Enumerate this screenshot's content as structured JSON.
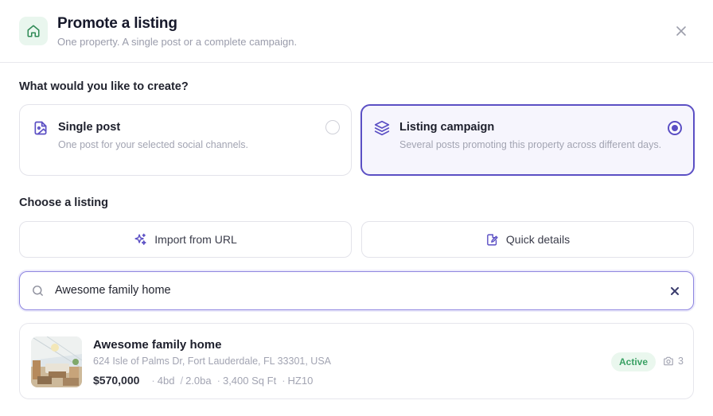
{
  "dialog": {
    "title": "Promote a listing",
    "subtitle": "One property. A single post or a complete campaign."
  },
  "create_section": {
    "label": "What would you like to create?",
    "options": [
      {
        "title": "Single post",
        "description": "One post for your selected social channels.",
        "selected": false,
        "icon": "image-post-icon"
      },
      {
        "title": "Listing campaign",
        "description": "Several posts promoting this property across different days.",
        "selected": true,
        "icon": "layers-icon"
      }
    ]
  },
  "listing_section": {
    "label": "Choose a listing",
    "import_button": "Import from URL",
    "quick_details_button": "Quick details"
  },
  "search": {
    "value": "Awesome family home",
    "placeholder": ""
  },
  "result": {
    "title": "Awesome family home",
    "address": "624 Isle of Palms Dr, Fort Lauderdale, FL 33301, USA",
    "price": "$570,000",
    "beds": "4bd",
    "baths": "2.0ba",
    "area": "3,400 Sq Ft",
    "code": "HZ10",
    "status": "Active",
    "photo_count": "3"
  },
  "colors": {
    "accent": "#5b4fc4",
    "success": "#3aa164",
    "success_bg": "#eaf7ee"
  }
}
